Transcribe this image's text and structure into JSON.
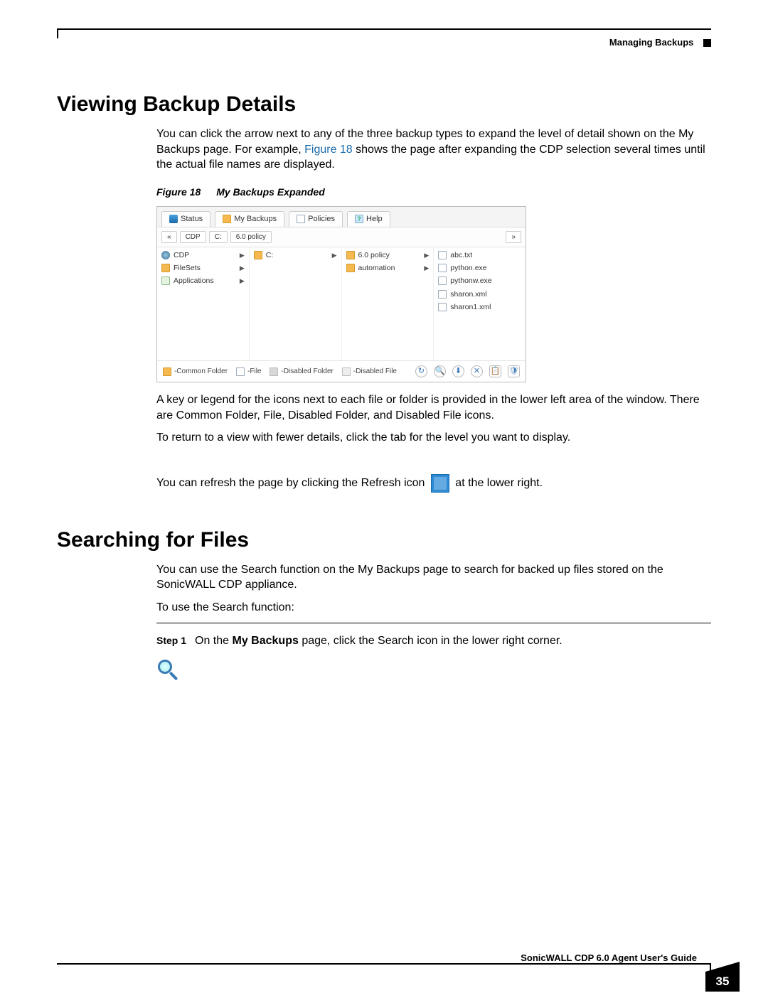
{
  "header": {
    "section": "Managing Backups"
  },
  "h1a": "Viewing Backup Details",
  "para1a": "You can click the arrow next to any of the three backup types to expand the level of detail shown on the My Backups page. For example, ",
  "figref": "Figure 18",
  "para1b": " shows the page after expanding the CDP selection several times until the actual file names are displayed.",
  "fig": {
    "num": "Figure 18",
    "title": "My Backups Expanded"
  },
  "shot": {
    "tabs": {
      "status": "Status",
      "backups": "My Backups",
      "policies": "Policies",
      "help": "Help"
    },
    "bc": {
      "back": "«",
      "cdp": "CDP",
      "c": "C:",
      "policy": "6.0 policy",
      "fwd": "»"
    },
    "col1": [
      {
        "icon": "globe",
        "label": "CDP",
        "arrow": true
      },
      {
        "icon": "folder",
        "label": "FileSets",
        "arrow": true
      },
      {
        "icon": "apps",
        "label": "Applications",
        "arrow": true
      }
    ],
    "col2": [
      {
        "icon": "folder",
        "label": "C:",
        "arrow": true
      }
    ],
    "col3": [
      {
        "icon": "folder",
        "label": "6.0 policy",
        "arrow": true
      },
      {
        "icon": "folder",
        "label": "automation",
        "arrow": true
      }
    ],
    "col4": [
      {
        "icon": "file",
        "label": "abc.txt"
      },
      {
        "icon": "file",
        "label": "python.exe"
      },
      {
        "icon": "file",
        "label": "pythonw.exe"
      },
      {
        "icon": "file",
        "label": "sharon.xml"
      },
      {
        "icon": "file",
        "label": "sharon1.xml"
      }
    ],
    "legend": {
      "common": "-Common Folder",
      "file": "-File",
      "dfolder": "-Disabled Folder",
      "dfile": "-Disabled File"
    },
    "tools": {
      "refresh": "↻",
      "search": "🔍",
      "download": "⬇",
      "delete": "✕",
      "paste": "📋",
      "agent": "🛡"
    }
  },
  "para2": "A key or legend for the icons next to each file or folder is provided in the lower left area of the window. There are Common Folder, File, Disabled Folder, and Disabled File icons.",
  "para3": "To return to a view with fewer details, click the tab for the level you want to display.",
  "para4a": "You can refresh the page by clicking the Refresh icon ",
  "para4b": " at the lower right.",
  "h1b": "Searching for Files",
  "para5": "You can use the Search function on the My Backups page to search for backed up files stored on the SonicWALL CDP appliance.",
  "para6": "To use the Search function:",
  "step1": {
    "label": "Step 1",
    "t1": "On the ",
    "bold": "My Backups",
    "t2": " page, click the Search icon in the lower right corner."
  },
  "footer": {
    "guide": "SonicWALL CDP 6.0 Agent User's Guide",
    "page": "35"
  }
}
